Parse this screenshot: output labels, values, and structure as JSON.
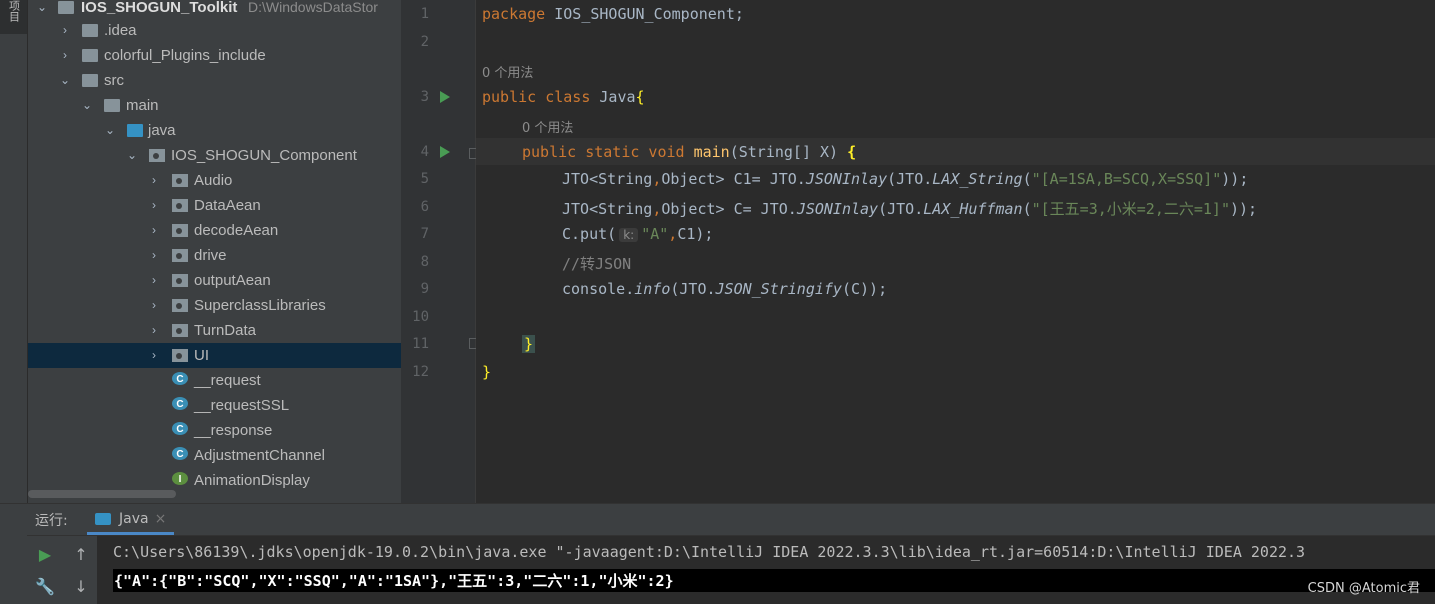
{
  "sidebar": {
    "tab_label": "项目"
  },
  "project_tree": {
    "root": {
      "name": "IOS_SHOGUN_Toolkit",
      "path": "D:\\WindowsDataStor"
    },
    "items": [
      {
        "label": ".idea",
        "icon": "folder-icon"
      },
      {
        "label": "colorful_Plugins_include",
        "icon": "folder-icon"
      },
      {
        "label": "src",
        "icon": "folder-icon"
      },
      {
        "label": "main",
        "icon": "folder-icon"
      },
      {
        "label": "java",
        "icon": "source-folder-icon"
      },
      {
        "label": "IOS_SHOGUN_Component",
        "icon": "package-icon"
      },
      {
        "label": "Audio",
        "icon": "package-icon"
      },
      {
        "label": "DataAean",
        "icon": "package-icon"
      },
      {
        "label": "decodeAean",
        "icon": "package-icon"
      },
      {
        "label": "drive",
        "icon": "package-icon"
      },
      {
        "label": "outputAean",
        "icon": "package-icon"
      },
      {
        "label": "SuperclassLibraries",
        "icon": "package-icon"
      },
      {
        "label": "TurnData",
        "icon": "package-icon"
      },
      {
        "label": "UI",
        "icon": "package-icon"
      },
      {
        "label": "__request",
        "icon": "class-icon"
      },
      {
        "label": "__requestSSL",
        "icon": "class-icon"
      },
      {
        "label": "__response",
        "icon": "class-icon"
      },
      {
        "label": "AdjustmentChannel",
        "icon": "class-icon"
      },
      {
        "label": "AnimationDisplay",
        "icon": "interface-icon"
      }
    ],
    "class_badge": "C",
    "interface_badge": "I"
  },
  "editor": {
    "line_numbers": [
      "1",
      "2",
      "3",
      "4",
      "5",
      "6",
      "7",
      "8",
      "9",
      "10",
      "11",
      "12"
    ],
    "usage_hint": "0 个用法",
    "lines": {
      "l1_kw": "package",
      "l1_rest": " IOS_SHOGUN_Component;",
      "l3_kw": "public class",
      "l3_name": " Java",
      "l3_brace": "{",
      "l4_kw": "public static void",
      "l4_fn": " main",
      "l4_rest": "(String[] X) ",
      "l4_brace": "{",
      "l5_a": "JTO",
      "l5_b": "<String",
      "l5_c": ",",
      "l5_d": "Object> C1= JTO.",
      "l5_e": "JSONInlay",
      "l5_f": "(JTO.",
      "l5_g": "LAX_String",
      "l5_h": "(",
      "l5_str": "\"[A=1SA,B=SCQ,X=SSQ]\"",
      "l5_end": "));",
      "l6_a": "JTO",
      "l6_b": "<String",
      "l6_c": ",",
      "l6_d": "Object> C= JTO.",
      "l6_e": "JSONInlay",
      "l6_f": "(JTO.",
      "l6_g": "LAX_Huffman",
      "l6_h": "(",
      "l6_str": "\"[王五=3,小米=2,二六=1]\"",
      "l6_end": "));",
      "l7_a": "C.put(",
      "l7_hint": "k:",
      "l7_str": "\"A\"",
      "l7_c": ",",
      "l7_end": "C1);",
      "l8_comment": "//转JSON",
      "l9_a": "console.",
      "l9_b": "info",
      "l9_c": "(JTO.",
      "l9_d": "JSON_Stringify",
      "l9_e": "(C));",
      "l11_brace": "}",
      "l12_brace": "}"
    }
  },
  "run_panel": {
    "label": "运行:",
    "tab_label": "Java",
    "close": "×",
    "command_line": "C:\\Users\\86139\\.jdks\\openjdk-19.0.2\\bin\\java.exe \"-javaagent:D:\\IntelliJ IDEA 2022.3.3\\lib\\idea_rt.jar=60514:D:\\IntelliJ IDEA 2022.3",
    "output": "{\"A\":{\"B\":\"SCQ\",\"X\":\"SSQ\",\"A\":\"1SA\"},\"王五\":3,\"二六\":1,\"小米\":2}",
    "tools": {
      "run": "▶",
      "up": "↑",
      "settings": "🔧",
      "down": "↓"
    }
  },
  "watermark": "CSDN @Atomic君"
}
